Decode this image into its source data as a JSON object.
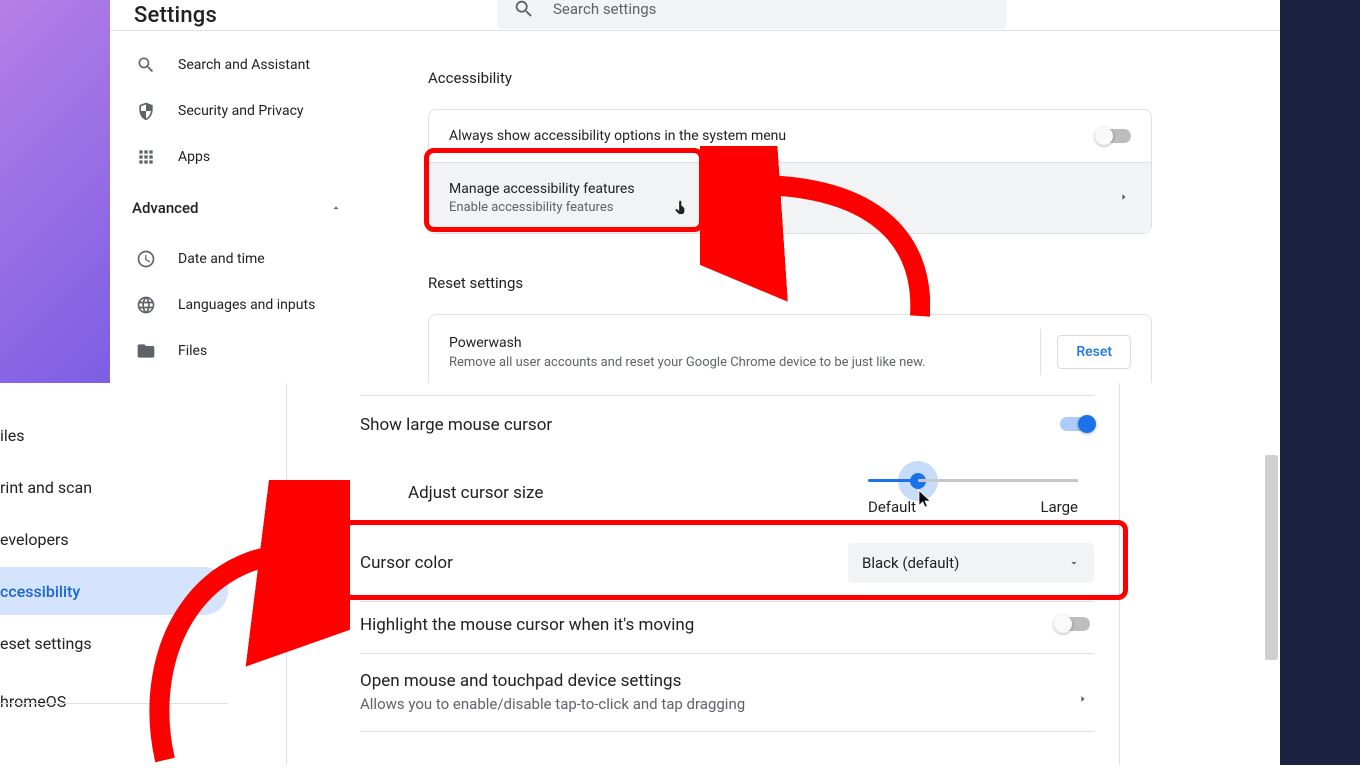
{
  "top": {
    "settings_title": "Settings",
    "search_placeholder": "Search settings",
    "sidebar": {
      "search_assistant": "Search and Assistant",
      "security_privacy": "Security and Privacy",
      "apps": "Apps",
      "advanced": "Advanced",
      "date_time": "Date and time",
      "languages": "Languages and inputs",
      "files": "Files"
    },
    "accessibility": {
      "heading": "Accessibility",
      "always_show": "Always show accessibility options in the system menu",
      "manage_title": "Manage accessibility features",
      "manage_sub": "Enable accessibility features"
    },
    "reset": {
      "heading": "Reset settings",
      "powerwash": "Powerwash",
      "powerwash_sub": "Remove all user accounts and reset your Google Chrome device to be just like new.",
      "reset_btn": "Reset"
    }
  },
  "bottom": {
    "sidebar": {
      "files": "iles",
      "print_scan": "rint and scan",
      "developers": "evelopers",
      "accessibility": "ccessibility",
      "reset_settings": "eset settings",
      "chromeos": "hromeOS"
    },
    "large_cursor": "Show large mouse cursor",
    "adjust_size": "Adjust cursor size",
    "slider_default": "Default",
    "slider_large": "Large",
    "cursor_color": "Cursor color",
    "cursor_color_value": "Black (default)",
    "highlight_moving": "Highlight the mouse cursor when it's moving",
    "open_mouse_title": "Open mouse and touchpad device settings",
    "open_mouse_sub": "Allows you to enable/disable tap-to-click and tap dragging"
  }
}
